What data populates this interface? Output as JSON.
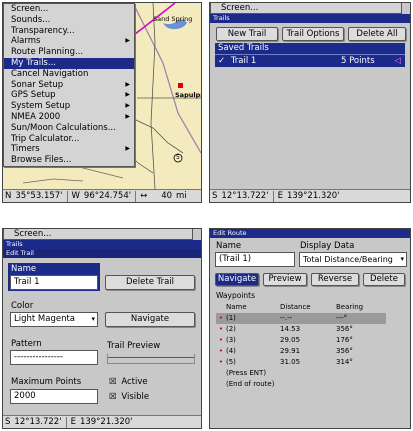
{
  "colors": {
    "accent": "#1c2a8a",
    "panel": "#c8c8c8",
    "map_bg": "#f3ebbd",
    "route_line": "#d400d4",
    "waypoint_dot": "#c0001a"
  },
  "p1": {
    "menu": [
      {
        "label": "Screen...",
        "submenu": false
      },
      {
        "label": "Sounds...",
        "submenu": false
      },
      {
        "label": "Transparency...",
        "submenu": false
      },
      {
        "label": "Alarms",
        "submenu": true
      },
      {
        "label": "Route Planning...",
        "submenu": false
      },
      {
        "label": "My Trails...",
        "submenu": false,
        "selected": true
      },
      {
        "label": "Cancel Navigation",
        "submenu": false
      },
      {
        "label": "Sonar Setup",
        "submenu": true
      },
      {
        "label": "GPS Setup",
        "submenu": true
      },
      {
        "label": "System Setup",
        "submenu": true
      },
      {
        "label": "NMEA 2000",
        "submenu": true
      },
      {
        "label": "Sun/Moon Calculations...",
        "submenu": false
      },
      {
        "label": "Trip Calculator...",
        "submenu": false
      },
      {
        "label": "Timers",
        "submenu": true
      },
      {
        "label": "Browse Files...",
        "submenu": false
      }
    ],
    "map_labels": {
      "city1": "Sand Spring",
      "city2": "Sapulpa",
      "road": "5"
    },
    "status": {
      "hemisphere_n": "N",
      "lat": "35°53.157'",
      "hemisphere_w": "W",
      "lon": "96°24.754'",
      "zoom_icon": "↔",
      "zoom": "40",
      "unit": "mi"
    }
  },
  "p2": {
    "screen_tab": "Screen...",
    "title": "Trails",
    "buttons": {
      "new_trail": "New Trail",
      "trail_options": "Trail Options",
      "delete_all": "Delete All"
    },
    "saved_header": "Saved Trails",
    "trail": {
      "check": "✓",
      "name": "Trail 1",
      "points": "5 Points",
      "icon": "◁"
    },
    "status": {
      "hemisphere_s": "S",
      "lat": "12°13.722'",
      "hemisphere_e": "E",
      "lon": "139°21.320'"
    }
  },
  "p3": {
    "screen_tab": "Screen...",
    "title_trails": "Trails",
    "title_edit": "Edit Trail",
    "name_label": "Name",
    "name_value": "Trail 1",
    "delete_button": "Delete Trail",
    "color_label": "Color",
    "color_value": "Light Magenta",
    "navigate_button": "Navigate",
    "pattern_label": "Pattern",
    "pattern_value": "----------------",
    "preview_label": "Trail Preview",
    "max_points_label": "Maximum Points",
    "max_points_value": "2000",
    "active_label": "Active",
    "visible_label": "Visible",
    "check_mark": "☒",
    "status": {
      "hemisphere_s": "S",
      "lat": "12°13.722'",
      "hemisphere_e": "E",
      "lon": "139°21.320'"
    }
  },
  "p4": {
    "title": "Edit Route",
    "name_label": "Name",
    "name_value": "(Trail 1)",
    "display_label": "Display Data",
    "display_value": "Total Distance/Bearing",
    "buttons": {
      "navigate": "Navigate",
      "preview": "Preview",
      "reverse": "Reverse",
      "delete": "Delete"
    },
    "waypoints_label": "Waypoints",
    "columns": [
      "Name",
      "Distance",
      "Bearing"
    ],
    "rows": [
      {
        "dot": "•",
        "name": "(1)",
        "distance": "--.--",
        "bearing": "---°",
        "highlight": true
      },
      {
        "dot": "•",
        "name": "(2)",
        "distance": "14.53",
        "bearing": "356°"
      },
      {
        "dot": "•",
        "name": "(3)",
        "distance": "29.05",
        "bearing": "176°"
      },
      {
        "dot": "•",
        "name": "(4)",
        "distance": "29.91",
        "bearing": "356°"
      },
      {
        "dot": "•",
        "name": "(5)",
        "distance": "31.05",
        "bearing": "314°"
      },
      {
        "dot": "",
        "name": "(Press ENT)",
        "distance": "",
        "bearing": ""
      },
      {
        "dot": "",
        "name": "(End of route)",
        "distance": "",
        "bearing": ""
      }
    ]
  }
}
